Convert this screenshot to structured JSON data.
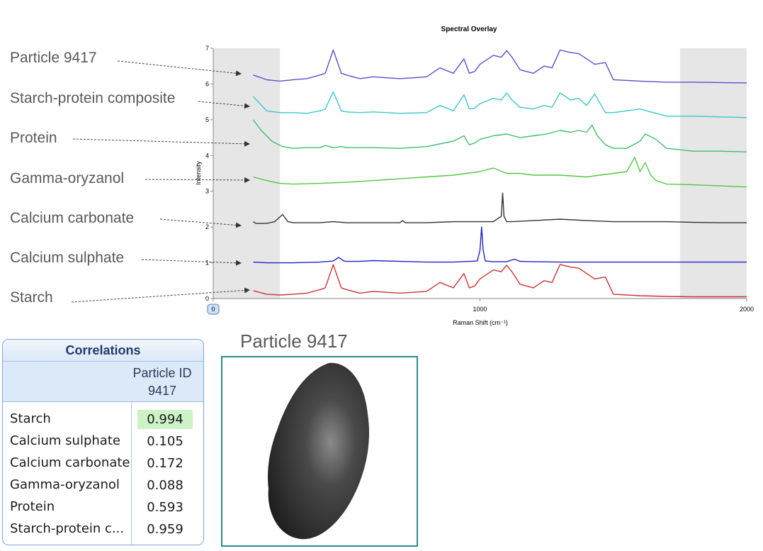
{
  "chart_data": {
    "type": "line",
    "title": "Spectral Overlay",
    "xlabel": "Raman Shift (cm⁻¹)",
    "ylabel": "Intensity",
    "xlim": [
      0,
      2000
    ],
    "ylim": [
      0,
      7
    ],
    "x_ticks": [
      "0",
      "1000",
      "2000"
    ],
    "y_ticks": [
      "0",
      "1",
      "2",
      "3",
      "4",
      "5",
      "6",
      "7"
    ],
    "grid": false,
    "shaded_regions": [
      [
        0,
        250
      ],
      [
        1750,
        2000
      ]
    ],
    "series": [
      {
        "name": "Particle 9417",
        "color": "#5a4fcf",
        "x": [
          150,
          200,
          250,
          300,
          350,
          400,
          420,
          450,
          480,
          500,
          550,
          600,
          700,
          800,
          850,
          900,
          940,
          960,
          980,
          1000,
          1050,
          1080,
          1100,
          1120,
          1150,
          1200,
          1240,
          1270,
          1300,
          1340,
          1370,
          1400,
          1430,
          1470,
          1500,
          1600,
          1700,
          1800,
          2000
        ],
        "y": [
          6.25,
          6.12,
          6.08,
          6.12,
          6.15,
          6.25,
          6.3,
          6.95,
          6.3,
          6.25,
          6.15,
          6.2,
          6.15,
          6.2,
          6.45,
          6.3,
          6.7,
          6.3,
          6.35,
          6.55,
          6.8,
          6.75,
          6.93,
          6.75,
          6.4,
          6.3,
          6.5,
          6.45,
          6.95,
          6.88,
          6.85,
          6.7,
          6.55,
          6.6,
          6.12,
          6.08,
          6.05,
          6.05,
          6.03
        ]
      },
      {
        "name": "Starch-protein composite",
        "color": "#3cc6cf",
        "x": [
          150,
          200,
          250,
          300,
          350,
          400,
          420,
          450,
          480,
          500,
          550,
          600,
          700,
          800,
          850,
          900,
          940,
          960,
          980,
          1000,
          1050,
          1080,
          1100,
          1120,
          1150,
          1200,
          1240,
          1270,
          1300,
          1340,
          1370,
          1400,
          1430,
          1470,
          1500,
          1600,
          1700,
          1800,
          1900,
          2000
        ],
        "y": [
          5.65,
          5.25,
          5.2,
          5.2,
          5.18,
          5.25,
          5.3,
          5.78,
          5.25,
          5.22,
          5.2,
          5.22,
          5.18,
          5.2,
          5.4,
          5.25,
          5.7,
          5.3,
          5.32,
          5.45,
          5.6,
          5.55,
          5.75,
          5.55,
          5.35,
          5.3,
          5.4,
          5.35,
          5.75,
          5.55,
          5.6,
          5.4,
          5.72,
          5.2,
          5.2,
          5.3,
          5.1,
          5.1,
          5.08,
          5.06
        ]
      },
      {
        "name": "Protein",
        "color": "#3dc06a",
        "x": [
          150,
          180,
          220,
          260,
          300,
          350,
          400,
          420,
          450,
          480,
          500,
          600,
          700,
          800,
          900,
          940,
          960,
          980,
          1000,
          1050,
          1100,
          1150,
          1200,
          1250,
          1300,
          1340,
          1370,
          1400,
          1420,
          1440,
          1470,
          1500,
          1550,
          1600,
          1620,
          1660,
          1700,
          1800,
          1900,
          2000
        ],
        "y": [
          5.0,
          4.7,
          4.4,
          4.25,
          4.2,
          4.22,
          4.22,
          4.28,
          4.22,
          4.25,
          4.22,
          4.22,
          4.2,
          4.25,
          4.4,
          4.55,
          4.3,
          4.35,
          4.45,
          4.55,
          4.6,
          4.5,
          4.55,
          4.6,
          4.7,
          4.65,
          4.7,
          4.65,
          4.85,
          4.55,
          4.3,
          4.2,
          4.2,
          4.4,
          4.6,
          4.45,
          4.2,
          4.12,
          4.12,
          4.1
        ]
      },
      {
        "name": "Gamma-oryzanol",
        "color": "#50c840",
        "x": [
          150,
          200,
          250,
          300,
          400,
          500,
          600,
          700,
          800,
          900,
          950,
          1000,
          1050,
          1100,
          1150,
          1200,
          1300,
          1400,
          1450,
          1500,
          1550,
          1580,
          1600,
          1620,
          1640,
          1660,
          1700,
          1800,
          1900,
          2000
        ],
        "y": [
          3.4,
          3.3,
          3.22,
          3.2,
          3.22,
          3.25,
          3.3,
          3.35,
          3.4,
          3.45,
          3.5,
          3.55,
          3.65,
          3.5,
          3.5,
          3.45,
          3.45,
          3.4,
          3.45,
          3.5,
          3.55,
          3.95,
          3.55,
          3.8,
          3.45,
          3.3,
          3.2,
          3.18,
          3.15,
          3.12
        ]
      },
      {
        "name": "Calcium carbonate",
        "color": "#333333",
        "x": [
          150,
          160,
          180,
          200,
          230,
          260,
          280,
          300,
          400,
          450,
          500,
          700,
          710,
          720,
          800,
          900,
          1000,
          1050,
          1080,
          1085,
          1090,
          1100,
          1120,
          1200,
          1300,
          1400,
          1500,
          1600,
          1700,
          1800,
          1900,
          2000
        ],
        "y": [
          2.15,
          2.1,
          2.1,
          2.1,
          2.15,
          2.35,
          2.15,
          2.12,
          2.12,
          2.15,
          2.12,
          2.12,
          2.18,
          2.12,
          2.12,
          2.15,
          2.15,
          2.15,
          2.3,
          2.95,
          2.3,
          2.15,
          2.15,
          2.18,
          2.22,
          2.18,
          2.15,
          2.15,
          2.15,
          2.13,
          2.12,
          2.12
        ]
      },
      {
        "name": "Calcium sulphate",
        "color": "#2222cc",
        "x": [
          150,
          200,
          300,
          400,
          450,
          470,
          490,
          500,
          550,
          600,
          700,
          800,
          900,
          990,
          1000,
          1006,
          1012,
          1020,
          1050,
          1100,
          1130,
          1150,
          1200,
          1300,
          1400,
          1500,
          1600,
          1700,
          1800,
          1900,
          2000
        ],
        "y": [
          1.02,
          1.0,
          1.0,
          1.02,
          1.05,
          1.15,
          1.05,
          1.04,
          1.04,
          1.06,
          1.04,
          1.02,
          1.02,
          1.05,
          1.35,
          2.0,
          1.35,
          1.05,
          1.03,
          1.03,
          1.1,
          1.04,
          1.03,
          1.02,
          1.02,
          1.02,
          1.02,
          1.02,
          1.02,
          1.02,
          1.02
        ]
      },
      {
        "name": "Starch",
        "color": "#cc3333",
        "x": [
          150,
          200,
          250,
          300,
          350,
          400,
          420,
          450,
          480,
          500,
          550,
          600,
          700,
          800,
          850,
          900,
          940,
          960,
          980,
          1000,
          1050,
          1080,
          1100,
          1120,
          1150,
          1200,
          1240,
          1270,
          1300,
          1340,
          1370,
          1400,
          1430,
          1470,
          1500,
          1600,
          1700,
          1800,
          2000
        ],
        "y": [
          0.22,
          0.12,
          0.1,
          0.12,
          0.15,
          0.25,
          0.3,
          0.95,
          0.3,
          0.25,
          0.15,
          0.2,
          0.15,
          0.2,
          0.45,
          0.3,
          0.7,
          0.3,
          0.35,
          0.55,
          0.8,
          0.75,
          0.93,
          0.75,
          0.4,
          0.3,
          0.5,
          0.45,
          0.95,
          0.88,
          0.85,
          0.7,
          0.55,
          0.6,
          0.12,
          0.08,
          0.06,
          0.05,
          0.05
        ]
      }
    ]
  },
  "chart_title": "Spectral Overlay",
  "axis": {
    "xlabel": "Raman Shift (cm⁻¹)",
    "ylabel": "Intensity"
  },
  "callouts": [
    "Particle 9417",
    "Starch-protein composite",
    "Protein",
    "Gamma-oryzanol",
    "Calcium carbonate",
    "Calcium sulphate",
    "Starch"
  ],
  "correlations": {
    "title": "Correlations",
    "column_header_line1": "Particle ID",
    "column_header_line2": "9417",
    "highlight_color": "#ccf2c6",
    "rows": [
      {
        "name": "Starch",
        "value": "0.994"
      },
      {
        "name": "Calcium sulphate",
        "value": "0.105"
      },
      {
        "name": "Calcium carbonate",
        "value": "0.172"
      },
      {
        "name": "Gamma-oryzanol",
        "value": "0.088"
      },
      {
        "name": "Protein",
        "value": "0.593"
      },
      {
        "name": "Starch-protein c...",
        "value": "0.959"
      }
    ]
  },
  "particle_image": {
    "title": "Particle 9417"
  }
}
